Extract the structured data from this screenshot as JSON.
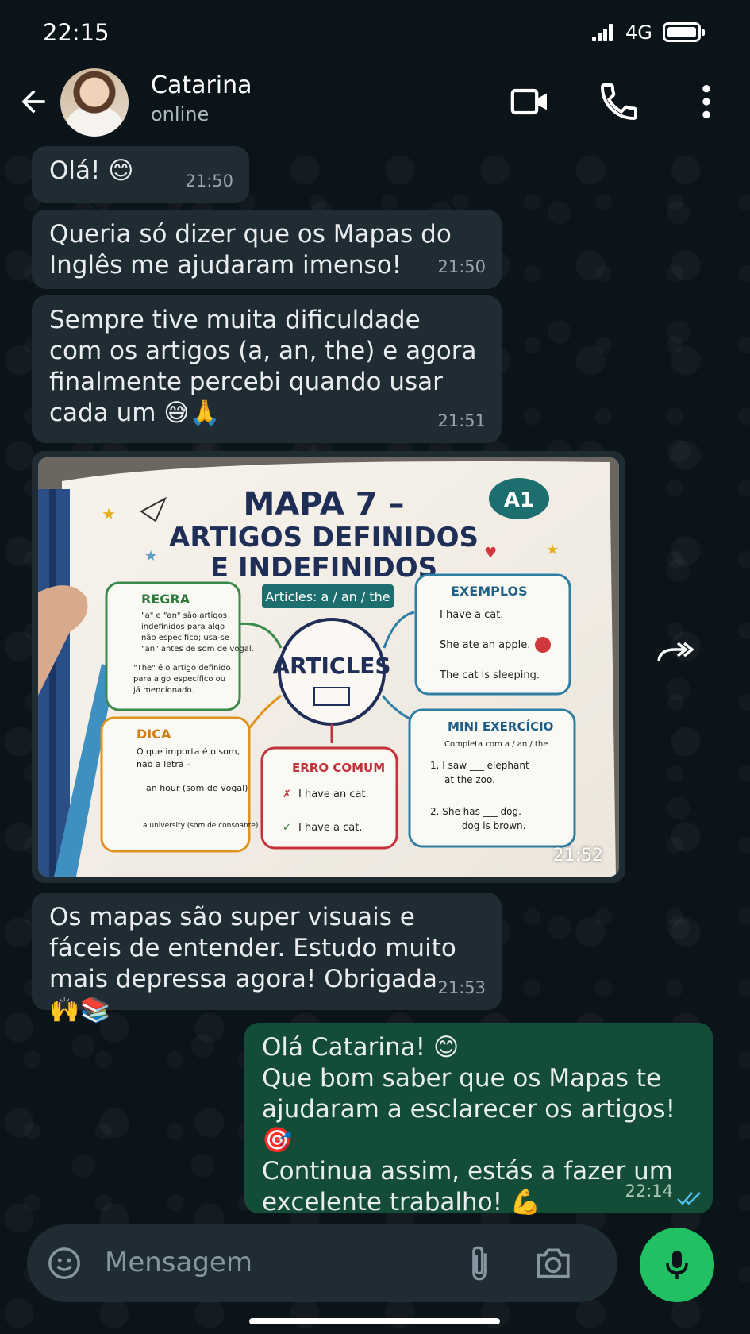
{
  "status_bar": {
    "time": "22:15",
    "network": "4G"
  },
  "header": {
    "contact_name": "Catarina",
    "contact_status": "online"
  },
  "messages": [
    {
      "text": "Olá! 😊",
      "time": "21:50"
    },
    {
      "text": "Queria só dizer que os Mapas do Inglês me ajudaram imenso!",
      "time": "21:50"
    },
    {
      "text": "Sempre tive muita dificuldade com os artigos (a, an, the) e agora finalmente percebi quando usar cada um 😅🙏",
      "time": "21:51"
    },
    {
      "image_time": "21:52"
    },
    {
      "text": "Os mapas são super visuais e fáceis de entender. Estudo muito mais depressa agora! Obrigada 🙌📚",
      "time": "21:53"
    },
    {
      "text": "Olá Catarina! 😊\nQue bom saber que os Mapas te ajudaram a esclarecer os artigos! 🎯\nContinua assim, estás a fazer um excelente trabalho! 💪",
      "time": "22:14"
    }
  ],
  "image": {
    "title_line1": "MAPA 7 –",
    "title_line2": "ARTIGOS DEFINIDOS",
    "title_line3": "E INDEFINIDOS",
    "level": "A1",
    "ribbon": "Articles: a / an / the",
    "center": "ARTICLES",
    "regra": {
      "title": "REGRA",
      "l1": "\"a\" e \"an\" são artigos",
      "l2": "indefinidos para algo",
      "l3": "não específico; usa-se",
      "l4": "\"an\" antes de som de vogal.",
      "l5": "\"The\" é o artigo definido",
      "l6": "para algo específico ou",
      "l7": "já mencionado."
    },
    "exemplos": {
      "title": "EXEMPLOS",
      "e1": "I have a cat.",
      "e2": "She ate an apple.",
      "e3": "The cat is sleeping."
    },
    "dica": {
      "title": "DICA",
      "l1": "O que importa é o som,",
      "l2": "não a letra –",
      "l3": "an hour (som de vogal)",
      "l4": "a university (som de consoante)"
    },
    "erro": {
      "title": "ERRO COMUM",
      "wrong": "I have an cat.",
      "right": "I have a cat."
    },
    "exercicio": {
      "title": "MINI EXERCÍCIO",
      "sub": "Completa com a / an / the",
      "q1a": "1. I saw ___ elephant",
      "q1b": "at the zoo.",
      "q2a": "2. She has ___ dog.",
      "q2b": "___ dog is brown."
    }
  },
  "input": {
    "placeholder": "Mensagem"
  },
  "colors": {
    "accent_green": "#21c063",
    "outgoing_bubble": "#144d37",
    "incoming_bubble": "#202c33",
    "background": "#0b1419",
    "read_ticks": "#53bdeb"
  },
  "icons": [
    "back-arrow-icon",
    "video-call-icon",
    "phone-icon",
    "more-vert-icon",
    "forward-icon",
    "emoji-icon",
    "attach-icon",
    "camera-icon",
    "mic-icon",
    "double-check-icon"
  ]
}
